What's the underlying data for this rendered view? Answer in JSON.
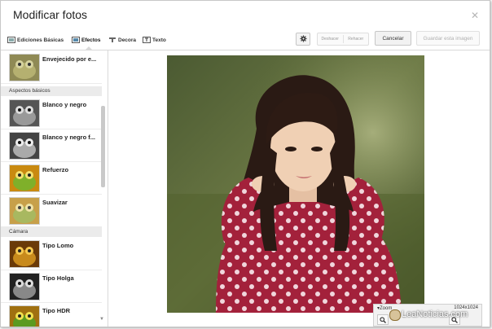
{
  "window": {
    "title": "Modificar fotos"
  },
  "toolbar": {
    "tabs": [
      {
        "label": "Ediciones Básicas",
        "icon": "basic-edits-icon"
      },
      {
        "label": "Efectos",
        "icon": "effects-icon",
        "active": true
      },
      {
        "label": "Decora",
        "icon": "decorate-icon"
      },
      {
        "label": "Texto",
        "icon": "text-icon"
      }
    ],
    "undo_label": "Deshacer",
    "redo_label": "Rehacer",
    "cancel_label": "Cancelar",
    "save_label": "Guardar esta imagen"
  },
  "sidebar": {
    "top_item": {
      "label": "Envejecido por e...",
      "thumb_style": "aged"
    },
    "sections": [
      {
        "header": "Aspectos básicos",
        "items": [
          {
            "label": "Blanco y negro",
            "thumb_style": "bw"
          },
          {
            "label": "Blanco y negro f...",
            "thumb_style": "bw"
          },
          {
            "label": "Refuerzo",
            "thumb_style": "color"
          },
          {
            "label": "Suavizar",
            "thumb_style": "soft"
          }
        ]
      },
      {
        "header": "Cámara",
        "items": [
          {
            "label": "Tipo Lomo",
            "thumb_style": "lomo"
          },
          {
            "label": "Tipo Holga",
            "thumb_style": "bw"
          },
          {
            "label": "Tipo HDR",
            "thumb_style": "color"
          }
        ]
      }
    ]
  },
  "zoom": {
    "title": "Zoom",
    "size": "1024x1024"
  },
  "watermark": "LeaNoticias.com",
  "colors": {
    "accent_border": "#d9d9d9",
    "section_bg": "#ebebeb"
  }
}
